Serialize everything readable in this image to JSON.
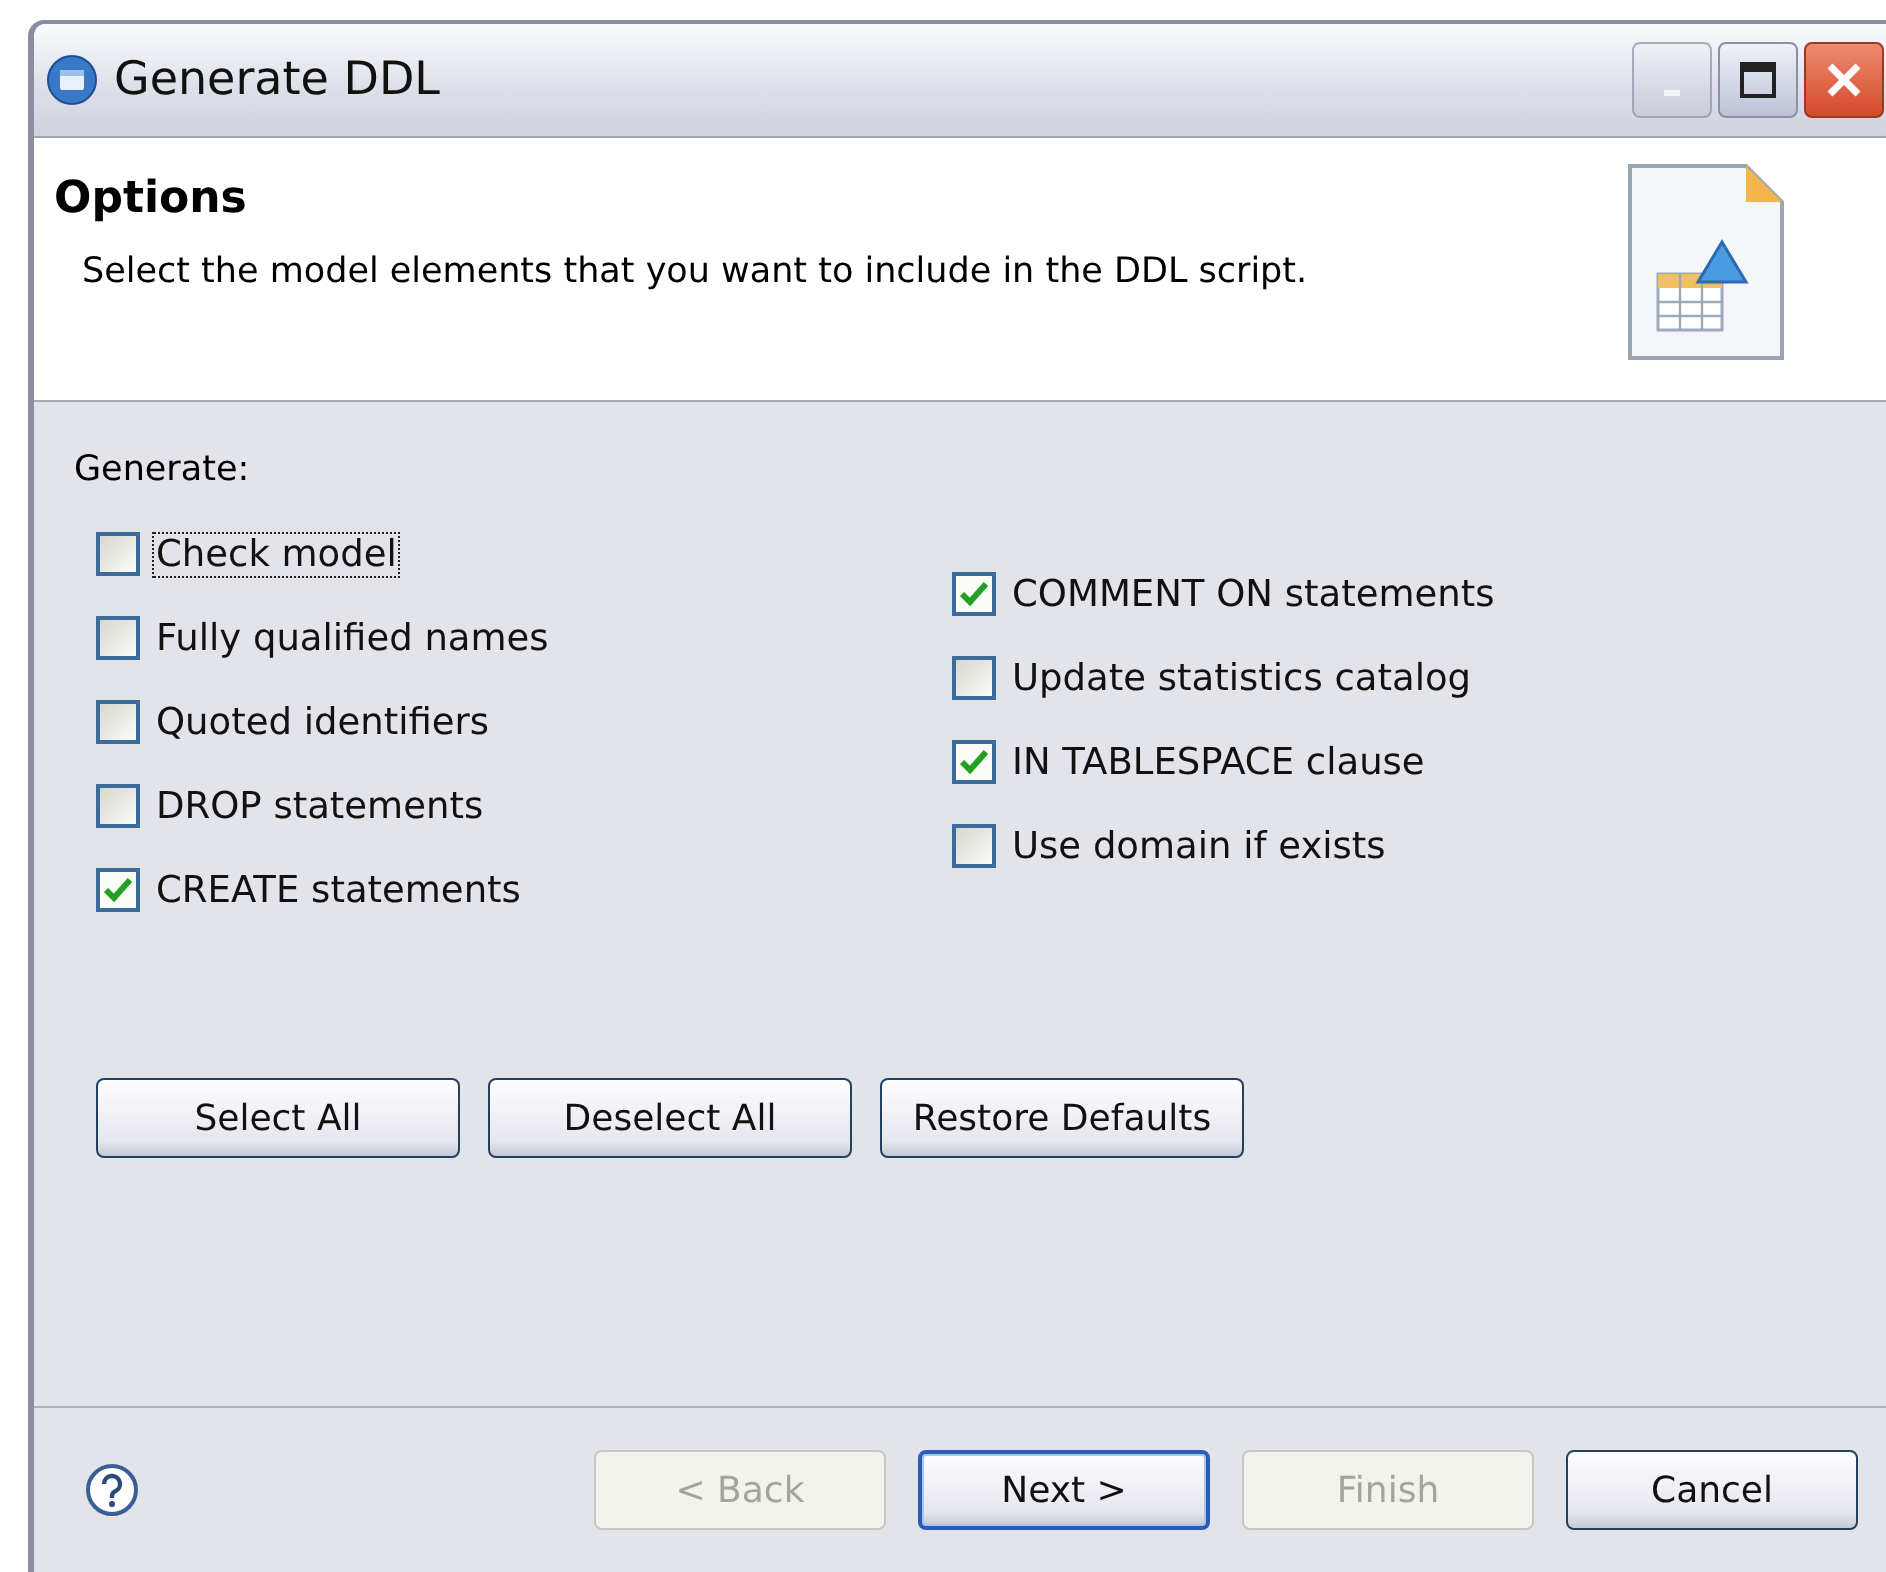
{
  "window": {
    "title": "Generate DDL"
  },
  "header": {
    "title": "Options",
    "description": "Select the model elements that you want to include in the DDL script."
  },
  "group_label": "Generate:",
  "options_left": [
    {
      "label": "Check model",
      "checked": false,
      "focused": true
    },
    {
      "label": "Fully qualified names",
      "checked": false,
      "focused": false
    },
    {
      "label": "Quoted identifiers",
      "checked": false,
      "focused": false
    },
    {
      "label": "DROP statements",
      "checked": false,
      "focused": false
    },
    {
      "label": "CREATE statements",
      "checked": true,
      "focused": false
    }
  ],
  "options_right": [
    {
      "label": "COMMENT ON statements",
      "checked": true,
      "focused": false
    },
    {
      "label": "Update statistics catalog",
      "checked": false,
      "focused": false
    },
    {
      "label": "IN TABLESPACE clause",
      "checked": true,
      "focused": false
    },
    {
      "label": "Use domain if exists",
      "checked": false,
      "focused": false
    }
  ],
  "selection_buttons": [
    "Select All",
    "Deselect All",
    "Restore Defaults"
  ],
  "footer_buttons": [
    {
      "label": "< Back",
      "disabled": true,
      "default": false
    },
    {
      "label": "Next >",
      "disabled": false,
      "default": true
    },
    {
      "label": "Finish",
      "disabled": true,
      "default": false
    },
    {
      "label": "Cancel",
      "disabled": false,
      "default": false
    }
  ]
}
